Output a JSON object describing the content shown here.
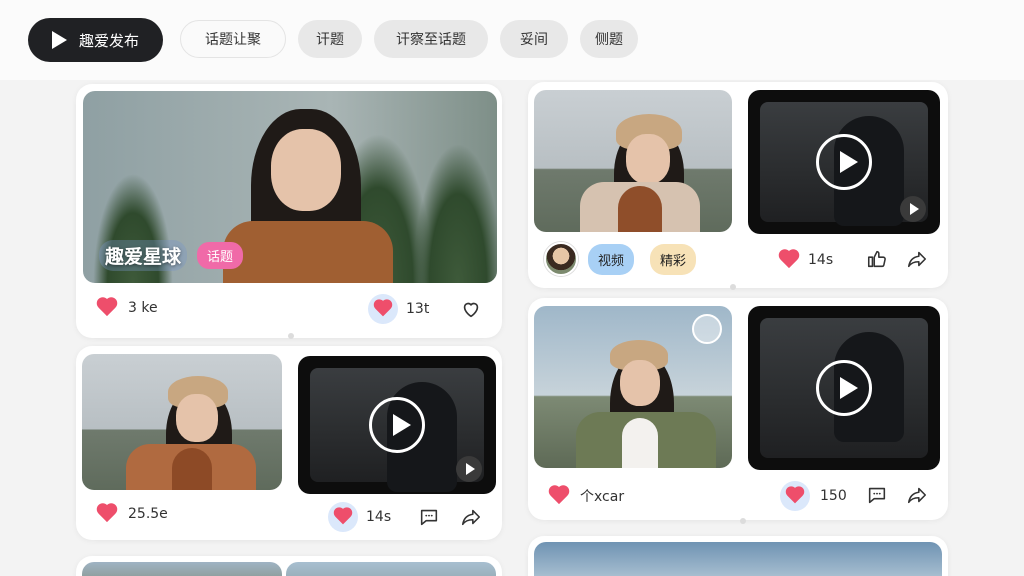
{
  "topbar": {
    "primary_label": "趣爱发布",
    "pills": [
      "话题让聚",
      "讦题",
      "讦察至话题",
      "妥间",
      "侧题"
    ]
  },
  "cards": {
    "c1": {
      "title": "趣爱星球",
      "tag": "话题",
      "likes": "3 ke",
      "comments": "13t"
    },
    "c2": {
      "tags": [
        "视频",
        "精彩"
      ],
      "likes": "14s"
    },
    "c3": {
      "likes": "25.5e",
      "comments": "14s"
    },
    "c4": {
      "likes": "个xcar",
      "comments": "150"
    }
  },
  "icons": [
    "play-icon",
    "heart-icon",
    "comment-icon",
    "share-icon",
    "thumbs-up-icon",
    "refresh-icon"
  ],
  "colors": {
    "accent": "#ee4e6b",
    "primary_dark": "#202124",
    "tag_pink": "#f06aa8",
    "chip_blue": "#a8d0f5",
    "chip_yellow": "#f7e2b7"
  }
}
